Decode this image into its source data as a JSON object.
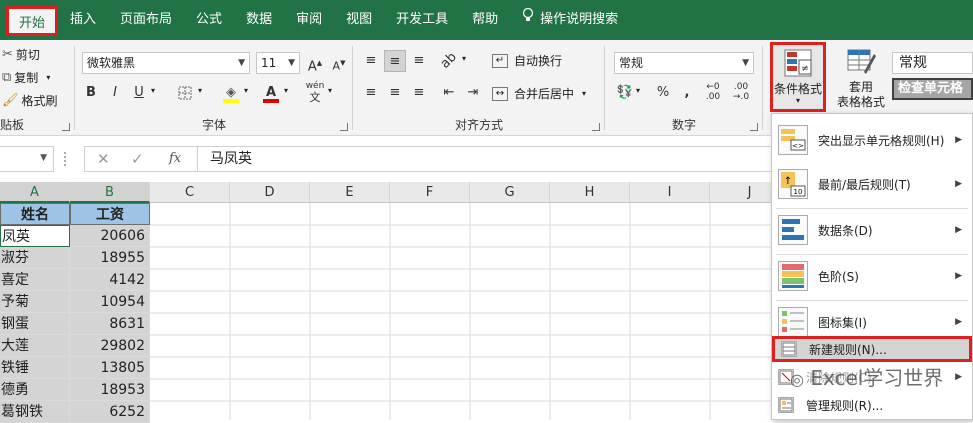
{
  "tabs": [
    "开始",
    "插入",
    "页面布局",
    "公式",
    "数据",
    "审阅",
    "视图",
    "开发工具",
    "帮助",
    "操作说明搜索"
  ],
  "clipboard": {
    "cut": "剪切",
    "copy": "复制",
    "format_painter": "格式刷",
    "group": "贴板"
  },
  "font": {
    "name": "微软雅黑",
    "size": "11",
    "grow": "A",
    "shrink": "A",
    "bold": "B",
    "italic": "I",
    "underline": "U",
    "group": "字体",
    "phonetic": "wén"
  },
  "align": {
    "wrap": "自动换行",
    "merge": "合并后居中",
    "group": "对齐方式"
  },
  "number": {
    "format": "常规",
    "percent": "%",
    "comma": ",",
    "group": "数字"
  },
  "styles": {
    "conditional": "条件格式",
    "table_top": "套用",
    "table_bottom": "表格格式",
    "style_normal": "常规",
    "style_check": "检查单元格"
  },
  "formula_bar": {
    "name_box": "",
    "content": "马凤英"
  },
  "columns": [
    "A",
    "B",
    "C",
    "D",
    "E",
    "F",
    "G",
    "H",
    "I",
    "J"
  ],
  "table": {
    "headers": [
      "姓名",
      "工资"
    ],
    "rows": [
      {
        "name": "凤英",
        "salary": "20606"
      },
      {
        "name": "淑芬",
        "salary": "18955"
      },
      {
        "name": "喜定",
        "salary": "4142"
      },
      {
        "name": "予菊",
        "salary": "10954"
      },
      {
        "name": "钢蛋",
        "salary": "8631"
      },
      {
        "name": "大莲",
        "salary": "29802"
      },
      {
        "name": "铁锤",
        "salary": "13805"
      },
      {
        "name": "德勇",
        "salary": "18953"
      },
      {
        "name": "葛钢铁",
        "salary": "6252"
      }
    ]
  },
  "menu": {
    "highlight": "突出显示单元格规则(H)",
    "topbottom": "最前/最后规则(T)",
    "databar": "数据条(D)",
    "colorscale": "色阶(S)",
    "iconset": "图标集(I)",
    "new_rule": "新建规则(N)...",
    "clear_rule": "清除规则(C)",
    "manage_rule": "管理规则(R)..."
  },
  "watermark": "Excel学习世界",
  "colors": {
    "excel_green": "#217346",
    "highlight_red": "#e02020",
    "header_blue": "#9dc3e6"
  }
}
